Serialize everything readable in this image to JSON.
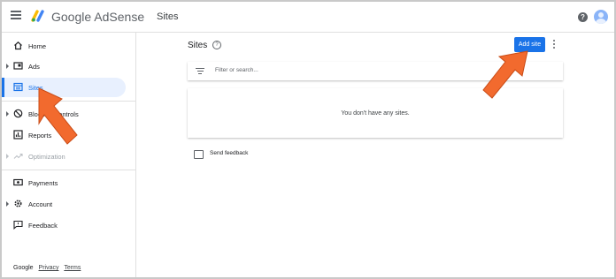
{
  "header": {
    "brand_google": "Google",
    "brand_product": "AdSense",
    "title": "Sites",
    "help_glyph": "?"
  },
  "sidebar": {
    "items": [
      {
        "label": "Home",
        "icon": "home-icon",
        "expandable": false,
        "active": false,
        "disabled": false
      },
      {
        "label": "Ads",
        "icon": "ads-icon",
        "expandable": true,
        "active": false,
        "disabled": false
      },
      {
        "label": "Sites",
        "icon": "sites-icon",
        "expandable": false,
        "active": true,
        "disabled": false
      },
      {
        "label": "Blocking controls",
        "icon": "block-icon",
        "expandable": true,
        "active": false,
        "disabled": false
      },
      {
        "label": "Reports",
        "icon": "reports-icon",
        "expandable": false,
        "active": false,
        "disabled": false
      },
      {
        "label": "Optimization",
        "icon": "optimization-icon",
        "expandable": true,
        "active": false,
        "disabled": true
      },
      {
        "label": "Payments",
        "icon": "payments-icon",
        "expandable": false,
        "active": false,
        "disabled": false
      },
      {
        "label": "Account",
        "icon": "account-gear-icon",
        "expandable": true,
        "active": false,
        "disabled": false
      },
      {
        "label": "Feedback",
        "icon": "feedback-icon",
        "expandable": false,
        "active": false,
        "disabled": false
      }
    ],
    "footer": {
      "google": "Google",
      "privacy": "Privacy",
      "terms": "Terms"
    }
  },
  "main": {
    "page_title": "Sites",
    "info_glyph": "?",
    "add_button_label": "Add site",
    "filter_placeholder": "Filter or search...",
    "empty_message": "You don't have any sites.",
    "send_feedback_label": "Send feedback"
  },
  "colors": {
    "accent": "#1a73e8",
    "active_bg": "#e8f0fe",
    "annotation_arrow": "#f26a2e"
  }
}
